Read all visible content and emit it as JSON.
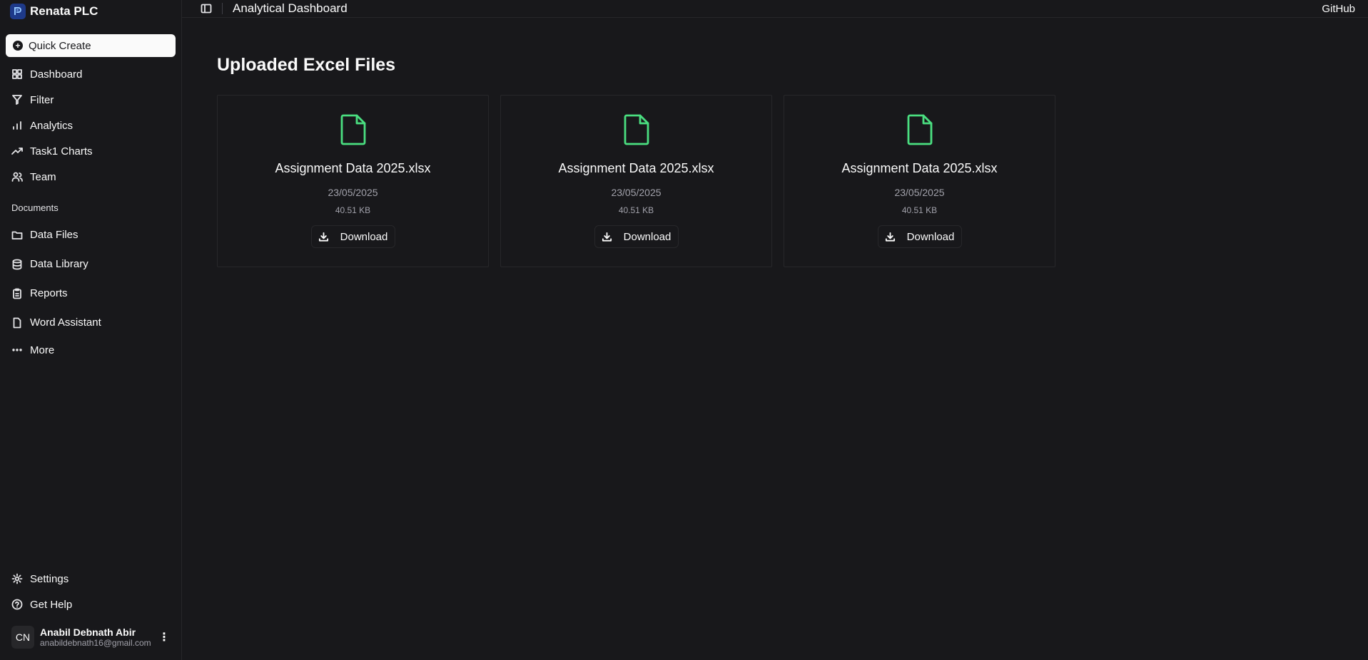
{
  "brand": {
    "name": "Renata PLC",
    "logo": "renata-logo-icon"
  },
  "sidebar": {
    "quick_create": "Quick Create",
    "main_items": [
      {
        "label": "Dashboard",
        "icon": "dashboard-icon"
      },
      {
        "label": "Filter",
        "icon": "filter-icon"
      },
      {
        "label": "Analytics",
        "icon": "bar-chart-icon"
      },
      {
        "label": "Task1 Charts",
        "icon": "trending-up-icon"
      },
      {
        "label": "Team",
        "icon": "users-icon"
      }
    ],
    "documents_label": "Documents",
    "doc_items": [
      {
        "label": "Data Files",
        "icon": "folder-icon"
      },
      {
        "label": "Data Library",
        "icon": "database-icon"
      },
      {
        "label": "Reports",
        "icon": "clipboard-icon"
      },
      {
        "label": "Word Assistant",
        "icon": "file-icon"
      },
      {
        "label": "More",
        "icon": "dots-icon"
      }
    ],
    "bottom_items": [
      {
        "label": "Settings",
        "icon": "gear-icon"
      },
      {
        "label": "Get Help",
        "icon": "help-icon"
      }
    ],
    "user": {
      "initials": "CN",
      "name": "Anabil Debnath Abir",
      "email": "anabildebnath16@gmail.com"
    }
  },
  "header": {
    "title": "Analytical Dashboard",
    "github": "GitHub"
  },
  "main": {
    "title": "Uploaded Excel Files",
    "download_label": "Download",
    "files": [
      {
        "name": "Assignment Data 2025.xlsx",
        "date": "23/05/2025",
        "size": "40.51 KB"
      },
      {
        "name": "Assignment Data 2025.xlsx",
        "date": "23/05/2025",
        "size": "40.51 KB"
      },
      {
        "name": "Assignment Data 2025.xlsx",
        "date": "23/05/2025",
        "size": "40.51 KB"
      }
    ]
  },
  "colors": {
    "background": "#18181b",
    "border": "#27272a",
    "file_icon": "#4ade80",
    "brand_logo": "#1e3a8a"
  }
}
